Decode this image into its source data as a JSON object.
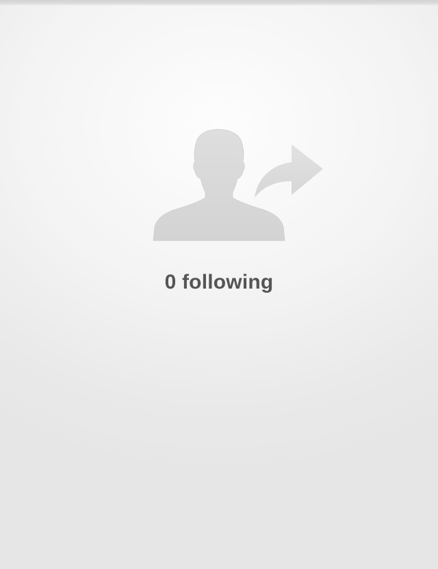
{
  "empty_state": {
    "icon": "person-follow-arrow",
    "message": "0 following"
  },
  "colors": {
    "background_light": "#fdfdfd",
    "background_dark": "#e6e6e6",
    "silhouette": "#d8d8d8",
    "text": "#555555"
  }
}
